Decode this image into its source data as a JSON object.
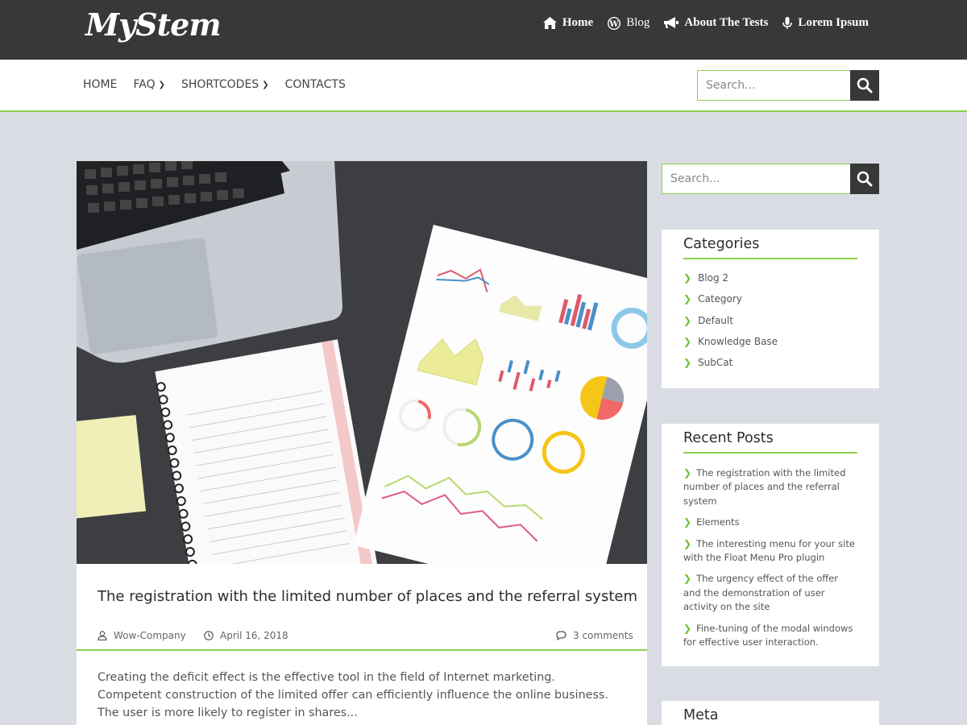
{
  "site": {
    "logo": "MyStem"
  },
  "top_nav": [
    {
      "label": "Home",
      "icon": "home-icon"
    },
    {
      "label": "Blog",
      "icon": "wordpress-icon"
    },
    {
      "label": "About The Tests",
      "icon": "megaphone-icon"
    },
    {
      "label": "Lorem Ipsum",
      "icon": "microphone-icon"
    }
  ],
  "main_menu": [
    {
      "label": "HOME",
      "has_dropdown": false
    },
    {
      "label": "FAQ",
      "has_dropdown": true
    },
    {
      "label": "SHORTCODES",
      "has_dropdown": true
    },
    {
      "label": "CONTACTS",
      "has_dropdown": false
    }
  ],
  "search": {
    "placeholder": "Search..."
  },
  "article": {
    "title": "The registration with the limited number of places and the referral system",
    "author": "Wow-Company",
    "date": "April 16, 2018",
    "comments": "3 comments",
    "excerpt": "Creating the deficit effect is the effective tool in the field of Internet marketing. Competent construction of the limited offer can efficiently influence the online business. The user is more likely to register in shares..."
  },
  "sidebar": {
    "categories": {
      "title": "Categories",
      "items": [
        "Blog 2",
        "Category",
        "Default",
        "Knowledge Base",
        "SubCat"
      ]
    },
    "recent_posts": {
      "title": "Recent Posts",
      "items": [
        "The registration with the limited number of places and the referral system",
        "Elements",
        "The interesting menu for your site with the Float Menu Pro plugin",
        "The urgency effect of the offer and the demonstration of user activity on the site",
        "Fine-tuning of the modal windows for effective user interaction."
      ]
    },
    "meta": {
      "title": "Meta"
    }
  },
  "colors": {
    "accent": "#8ed04a",
    "dark": "#383838",
    "background": "#d9dde3"
  }
}
